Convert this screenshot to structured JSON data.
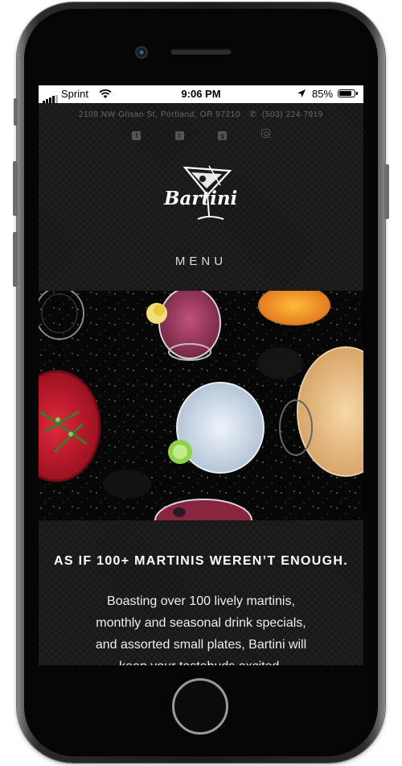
{
  "status_bar": {
    "carrier": "Sprint",
    "time": "9:06 PM",
    "battery_percent": "85%",
    "battery_level": 0.85,
    "signal_bars": 4
  },
  "site": {
    "address": "2108 NW Glisan St, Portland, OR 97210",
    "phone": "(503) 224 7919",
    "social_icons": [
      "facebook-icon",
      "twitter-icon",
      "google-plus-icon",
      "instagram-icon"
    ],
    "logo_text": "Bartini",
    "menu_label": "MENU"
  },
  "content": {
    "headline": "AS IF 100+ MARTINIS WEREN’T ENOUGH.",
    "body_lines": [
      "Boasting over 100 lively martinis,",
      "monthly and seasonal drink specials,",
      "and assorted small plates, Bartini will",
      "keep your tastebuds excited."
    ]
  },
  "colors": {
    "background": "#1b1b1b",
    "text_muted": "#6a6a6a",
    "text_light": "#dcdcdc"
  }
}
